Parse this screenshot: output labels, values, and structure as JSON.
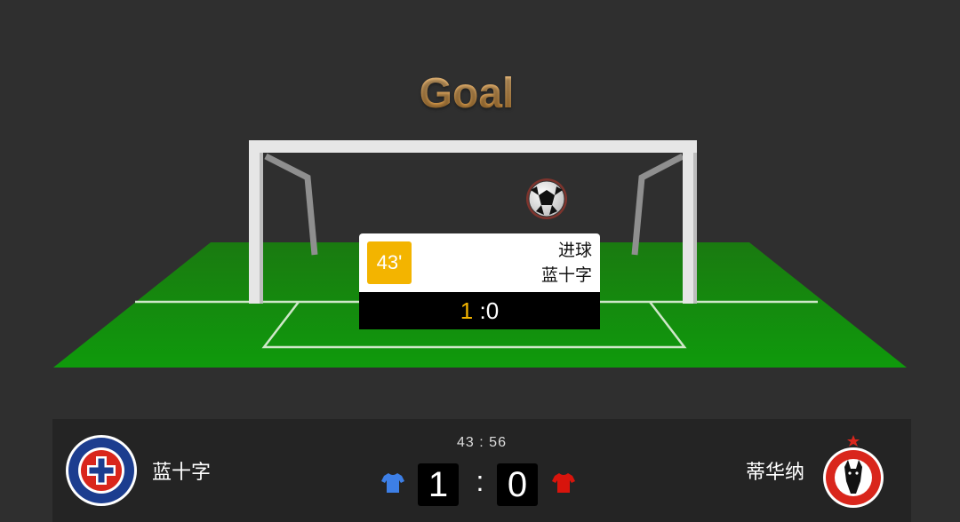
{
  "banner": {
    "title": "Goal"
  },
  "event": {
    "minute": "43'",
    "type": "进球",
    "team": "蓝十字",
    "score_home": "1",
    "score_sep": " :",
    "score_away": "0"
  },
  "scoreboard": {
    "clock": "43 : 56",
    "home": {
      "name": "蓝十字",
      "score": "1",
      "shirt_color": "#3d7fe6",
      "logo_icon": "cruz-azul-crest-icon"
    },
    "away": {
      "name": "蒂华纳",
      "score": "0",
      "shirt_color": "#d8140c",
      "logo_icon": "club-tijuana-crest-icon"
    },
    "separator": ":"
  },
  "colors": {
    "accent": "#f3b400",
    "pitch": "#1f8a12",
    "background": "#2f2f2f"
  }
}
